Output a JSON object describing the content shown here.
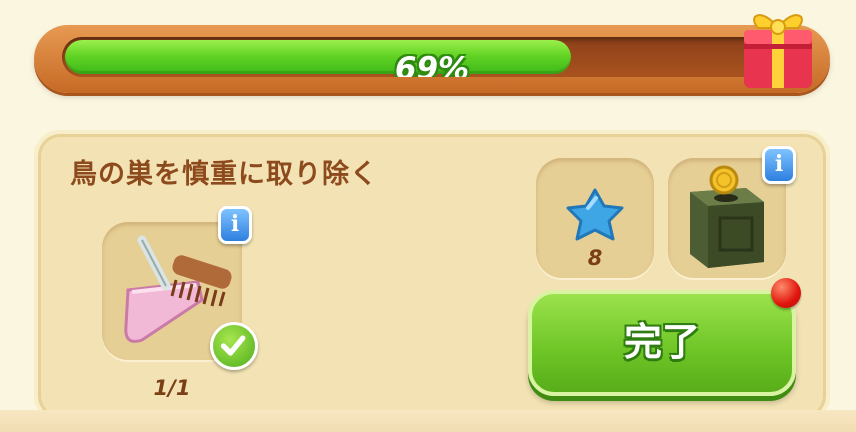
{
  "progress": {
    "percent_label": "69%",
    "value": 0.69
  },
  "task": {
    "title": "鳥の巣を慎重に取り除く",
    "item": {
      "icon": "dustpan-brush-icon",
      "count": "1/1",
      "completed": true
    },
    "rewards": [
      {
        "icon": "blue-star-icon",
        "amount": "8"
      },
      {
        "icon": "coin-box-icon"
      }
    ],
    "complete_button": "完了"
  },
  "colors": {
    "progress_fill": "#63d424",
    "frame": "#d47a33",
    "title": "#8c4a1d",
    "button": "#6dc425"
  }
}
